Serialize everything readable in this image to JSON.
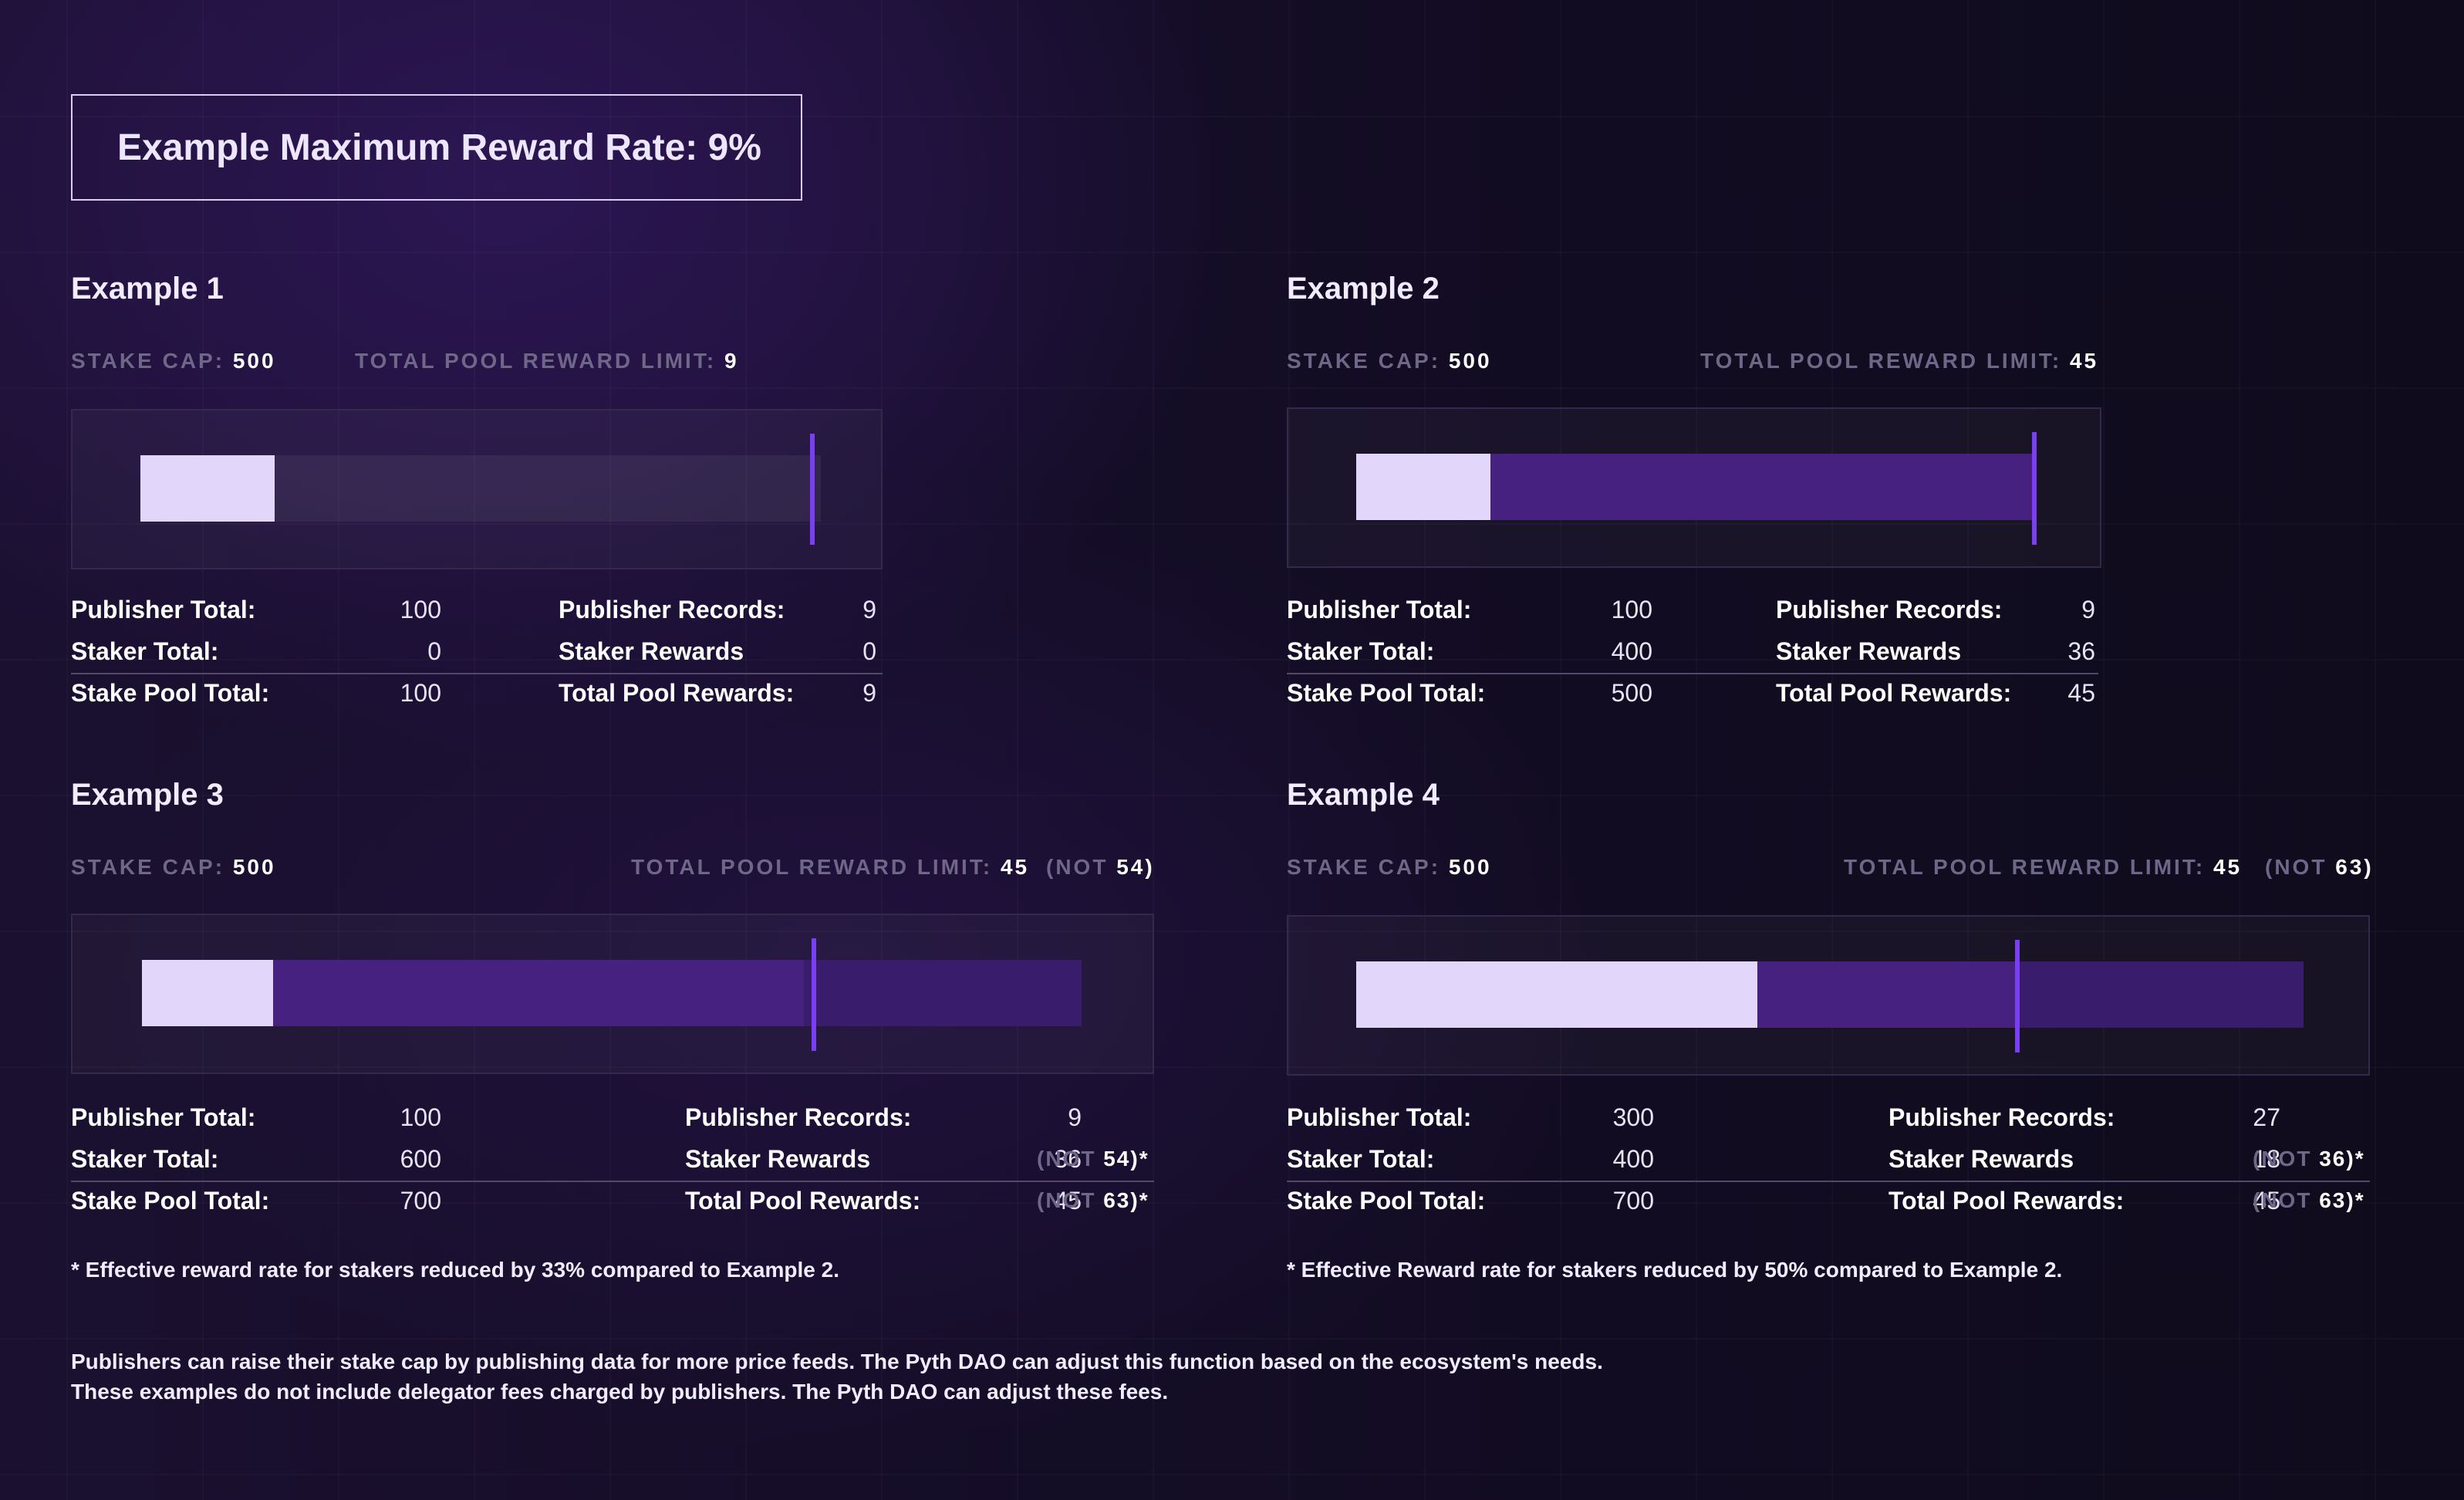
{
  "header": {
    "title": "Example Maximum Reward Rate: 9%"
  },
  "examples": [
    {
      "title": "Example 1",
      "stake_cap_label": "STAKE CAP:",
      "stake_cap": "500",
      "limit_label": "TOTAL POOL REWARD LIMIT:",
      "limit": "9",
      "publisher_total_label": "Publisher Total:",
      "publisher_total": "100",
      "staker_total_label": "Staker Total:",
      "staker_total": "0",
      "pool_total_label": "Stake Pool Total:",
      "pool_total": "100",
      "records_label": "Publisher Records:",
      "records": "9",
      "staker_rewards_label": "Staker Rewards",
      "staker_rewards": "0",
      "pool_rewards_label": "Total Pool Rewards:",
      "pool_rewards": "9"
    },
    {
      "title": "Example 2",
      "stake_cap_label": "STAKE CAP:",
      "stake_cap": "500",
      "limit_label": "TOTAL POOL REWARD LIMIT:",
      "limit": "45",
      "publisher_total_label": "Publisher Total:",
      "publisher_total": "100",
      "staker_total_label": "Staker Total:",
      "staker_total": "400",
      "pool_total_label": "Stake Pool Total:",
      "pool_total": "500",
      "records_label": "Publisher Records:",
      "records": "9",
      "staker_rewards_label": "Staker Rewards",
      "staker_rewards": "36",
      "pool_rewards_label": "Total Pool Rewards:",
      "pool_rewards": "45"
    },
    {
      "title": "Example 3",
      "stake_cap_label": "STAKE CAP:",
      "stake_cap": "500",
      "limit_label": "TOTAL POOL REWARD LIMIT:",
      "limit": "45",
      "limit_not_label": "(NOT",
      "limit_not": "54)",
      "publisher_total_label": "Publisher Total:",
      "publisher_total": "100",
      "staker_total_label": "Staker Total:",
      "staker_total": "600",
      "pool_total_label": "Stake Pool Total:",
      "pool_total": "700",
      "records_label": "Publisher Records:",
      "records": "9",
      "staker_rewards_label": "Staker Rewards",
      "staker_rewards": "36",
      "staker_rewards_not_label": "(NOT",
      "staker_rewards_not": "54)*",
      "pool_rewards_label": "Total Pool Rewards:",
      "pool_rewards": "45",
      "pool_rewards_not_label": "(NOT",
      "pool_rewards_not": "63)*",
      "note": "* Effective reward rate for stakers reduced by 33% compared to Example 2."
    },
    {
      "title": "Example 4",
      "stake_cap_label": "STAKE CAP:",
      "stake_cap": "500",
      "limit_label": "TOTAL POOL REWARD LIMIT:",
      "limit": "45",
      "limit_not_label": "(NOT",
      "limit_not": "63)",
      "publisher_total_label": "Publisher Total:",
      "publisher_total": "300",
      "staker_total_label": "Staker Total:",
      "staker_total": "400",
      "pool_total_label": "Stake Pool Total:",
      "pool_total": "700",
      "records_label": "Publisher Records:",
      "records": "27",
      "staker_rewards_label": "Staker Rewards",
      "staker_rewards": "18",
      "staker_rewards_not_label": "(NOT",
      "staker_rewards_not": "36)*",
      "pool_rewards_label": "Total Pool Rewards:",
      "pool_rewards": "45",
      "pool_rewards_not_label": "(NOT",
      "pool_rewards_not": "63)*",
      "note": "* Effective Reward rate for stakers reduced by 50% compared to Example 2."
    }
  ],
  "footer": {
    "line1": "Publishers can raise their stake cap by publishing data for more price feeds. The Pyth DAO can adjust this function based on the ecosystem's needs.",
    "line2": "These examples do not include delegator fees charged by publishers. The Pyth DAO can adjust these fees."
  },
  "colors": {
    "publisher_segment": "#e3d6fb",
    "staker_segment": "#47217f",
    "limit_marker": "#7b3ff2",
    "muted_label": "#6f6787"
  }
}
